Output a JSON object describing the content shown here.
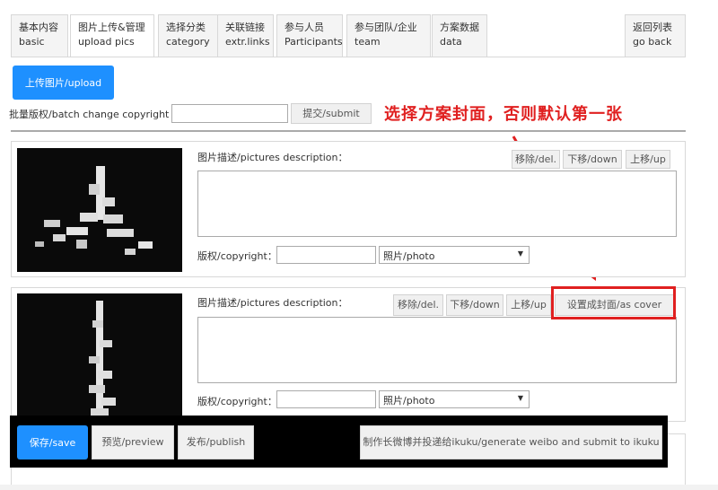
{
  "tabs": [
    {
      "zh": "基本内容",
      "en": "basic"
    },
    {
      "zh": "图片上传&管理",
      "en": "upload pics"
    },
    {
      "zh": "选择分类",
      "en": "category"
    },
    {
      "zh": "关联链接",
      "en": "extr.links"
    },
    {
      "zh": "参与人员",
      "en": "Participants"
    },
    {
      "zh": "参与团队/企业",
      "en": "team"
    },
    {
      "zh": "方案数据",
      "en": "data"
    }
  ],
  "goback": {
    "zh": "返回列表",
    "en": "go back"
  },
  "upload_button": "上传图片/upload",
  "batch": {
    "label": "批量版权/batch change copyright ：",
    "value": "",
    "submit": "提交/submit"
  },
  "annotation": "选择方案封面，否则默认第一张",
  "pictures": [
    {
      "desc_label": "图片描述/pictures description：",
      "description": "",
      "buttons": {
        "del": "移除/del.",
        "down": "下移/down",
        "up": "上移/up"
      },
      "copyright_label": "版权/copyright：",
      "copyright": "",
      "type": "照片/photo"
    },
    {
      "desc_label": "图片描述/pictures description：",
      "description": "",
      "buttons": {
        "del": "移除/del.",
        "down": "下移/down",
        "up": "上移/up",
        "cover": "设置成封面/as cover"
      },
      "copyright_label": "版权/copyright：",
      "copyright": "",
      "type": "照片/photo"
    }
  ],
  "bottom": {
    "save": "保存/save",
    "preview": "预览/preview",
    "publish": "发布/publish",
    "weibo": "制作长微博并投递给ikuku/generate weibo and submit to ikuku"
  },
  "colors": {
    "accent": "#1e90ff",
    "annotation": "#e02020",
    "bar": "#000000"
  }
}
